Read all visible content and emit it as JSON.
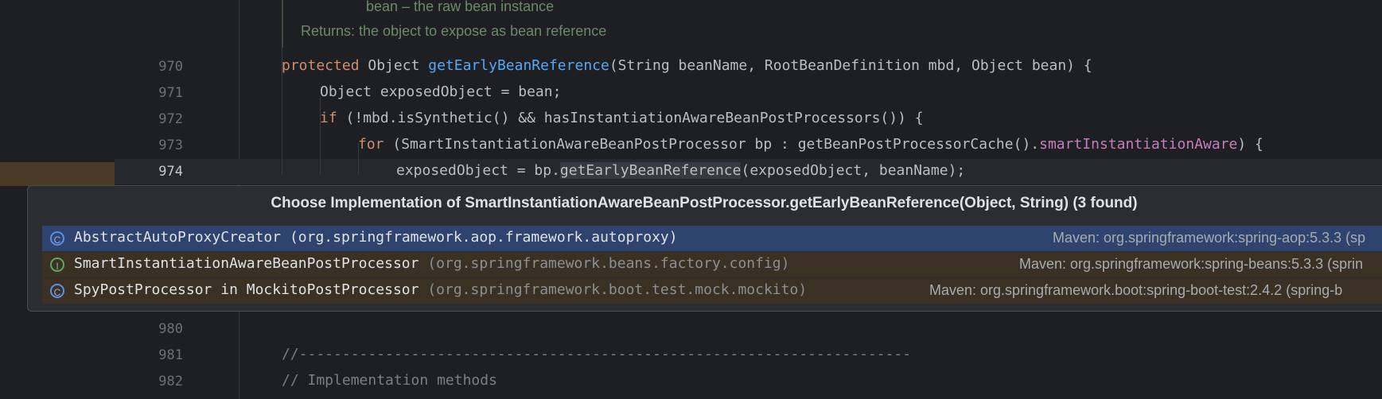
{
  "doc": {
    "param_line": "bean – the raw bean instance",
    "returns_line": "Returns: the object to expose as bean reference"
  },
  "line_numbers": [
    "970",
    "971",
    "972",
    "973",
    "974",
    "980",
    "981",
    "982"
  ],
  "code": {
    "l970": {
      "kw": "protected",
      "t1": " Object ",
      "fn": "getEarlyBeanReference",
      "t2": "(String beanName, RootBeanDefinition mbd, Object bean) {"
    },
    "l971": "Object exposedObject = bean;",
    "l972": {
      "kw": "if",
      "t1": " (!mbd.isSynthetic() && hasInstantiationAwareBeanPostProcessors()) {"
    },
    "l973": {
      "kw": "for",
      "t1": " (SmartInstantiationAwareBeanPostProcessor bp : getBeanPostProcessorCache().",
      "field": "smartInstantiationAware",
      "t2": ") {"
    },
    "l974": {
      "t1": "exposedObject = bp.",
      "hl": "getEarlyBeanReference",
      "t2": "(exposedObject, beanName);"
    },
    "l981": "//-----------------------------------------------------------------------",
    "l982": "// Implementation methods"
  },
  "popup": {
    "title": "Choose Implementation of SmartInstantiationAwareBeanPostProcessor.getEarlyBeanReference(Object, String) (3 found)",
    "items": [
      {
        "icon": "class-icon",
        "icon_glyph": "C",
        "name": "AbstractAutoProxyCreator",
        "package": "(org.springframework.aop.framework.autoproxy)",
        "library": "Maven: org.springframework:spring-aop:5.3.3 (sp"
      },
      {
        "icon": "interface-icon",
        "icon_glyph": "I",
        "name": "SmartInstantiationAwareBeanPostProcessor",
        "package": "(org.springframework.beans.factory.config)",
        "library": "Maven: org.springframework:spring-beans:5.3.3 (sprin"
      },
      {
        "icon": "class-icon",
        "icon_glyph": "C",
        "name": "SpyPostProcessor in MockitoPostProcessor",
        "package": "(org.springframework.boot.test.mock.mockito)",
        "library": "Maven: org.springframework.boot:spring-boot-test:2.4.2 (spring-b"
      }
    ]
  },
  "colors": {
    "editor_bg": "#1e1f22",
    "keyword": "#cf8e6d",
    "function": "#56a8f5",
    "field": "#c77dbb",
    "comment": "#7a7e85",
    "selected_row": "#2e436e",
    "row_bg": "#3a3023"
  }
}
